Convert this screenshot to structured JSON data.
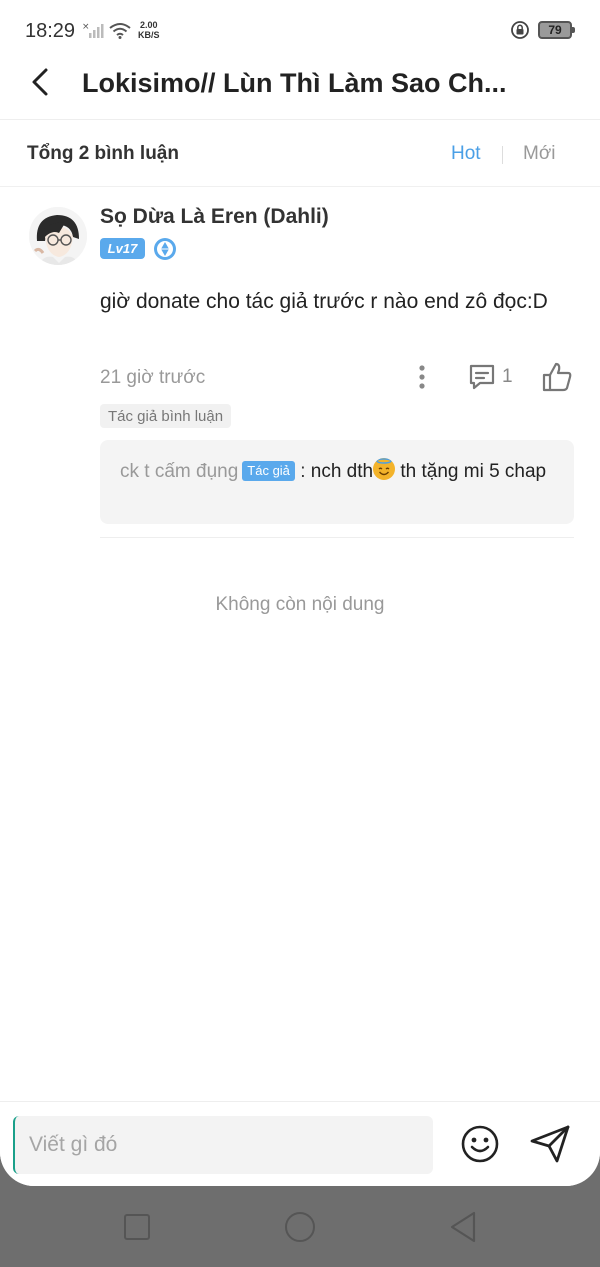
{
  "status_bar": {
    "time": "18:29",
    "net_speed_value": "2.00",
    "net_speed_unit": "KB/S",
    "battery": "79"
  },
  "header": {
    "title": "Lokisimo// Lùn Thì Làm Sao Ch..."
  },
  "summary": {
    "total": "Tổng 2 bình luận",
    "sort_hot": "Hot",
    "sort_new": "Mới"
  },
  "comment": {
    "username": "Sọ Dừa Là Eren (Dahli)",
    "level": "Lv17",
    "text": "giờ donate cho tác giả trước r nào end zô đọc:D",
    "time": "21 giờ trước",
    "reply_count": "1",
    "author_tag": "Tác giả bình luận",
    "reply": {
      "user": "ck t cấm đụng",
      "author_badge": "Tác giả",
      "colon": " : ",
      "text_before": "nch dth",
      "text_after": " th tặng mi 5 chap"
    }
  },
  "no_more": "Không còn nội dung",
  "input": {
    "placeholder": "Viết gì đó"
  },
  "colors": {
    "accent": "#4a9fe6",
    "badge": "#5aa9ec"
  }
}
